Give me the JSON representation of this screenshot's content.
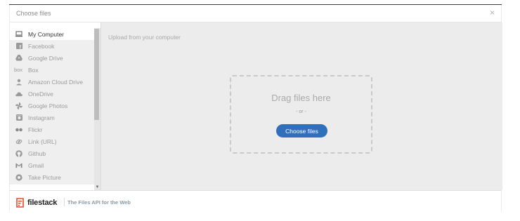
{
  "header": {
    "title": "Choose files",
    "close_symbol": "×"
  },
  "sidebar": {
    "items": [
      {
        "label": "My Computer",
        "icon": "computer-icon",
        "active": true
      },
      {
        "label": "Facebook",
        "icon": "facebook-icon"
      },
      {
        "label": "Google Drive",
        "icon": "google-drive-icon"
      },
      {
        "label": "Box",
        "icon": "box-icon"
      },
      {
        "label": "Amazon Cloud Drive",
        "icon": "amazon-cloud-drive-icon"
      },
      {
        "label": "OneDrive",
        "icon": "onedrive-icon"
      },
      {
        "label": "Google Photos",
        "icon": "google-photos-icon"
      },
      {
        "label": "Instagram",
        "icon": "instagram-icon"
      },
      {
        "label": "Flickr",
        "icon": "flickr-icon"
      },
      {
        "label": "Link (URL)",
        "icon": "link-icon"
      },
      {
        "label": "Github",
        "icon": "github-icon"
      },
      {
        "label": "Gmail",
        "icon": "gmail-icon"
      },
      {
        "label": "Take Picture",
        "icon": "camera-icon"
      }
    ],
    "box_icon_text": "box"
  },
  "main": {
    "breadcrumb": "Upload from your computer",
    "drop_title": "Drag files here",
    "drop_or": "- or -",
    "choose_button": "Choose files"
  },
  "footer": {
    "brand": "filestack",
    "tagline": "The Files API for the Web"
  },
  "colors": {
    "accent": "#2f6fbb",
    "logo": "#ef4a25"
  }
}
